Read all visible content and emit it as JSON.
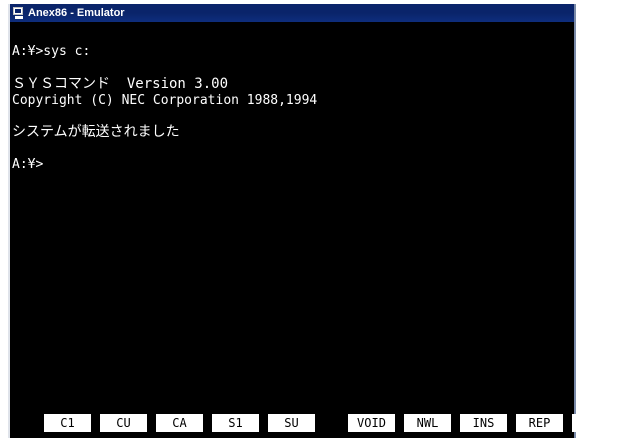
{
  "window": {
    "title": "Anex86 - Emulator"
  },
  "terminal": {
    "lines": [
      "A:¥>sys c:",
      "ＳＹＳコマンド  Version 3.00",
      "Copyright (C) NEC Corporation 1988,1994",
      "システムが転送されました",
      "A:¥>"
    ]
  },
  "function_keys": [
    "C1",
    "CU",
    "CA",
    "S1",
    "SU",
    "VOID",
    "NWL",
    "INS",
    "REP"
  ],
  "colors": {
    "titlebar": "#0a246a",
    "screen_bg": "#000000",
    "screen_text": "#ffffff",
    "fkey_bg": "#ffffff"
  }
}
